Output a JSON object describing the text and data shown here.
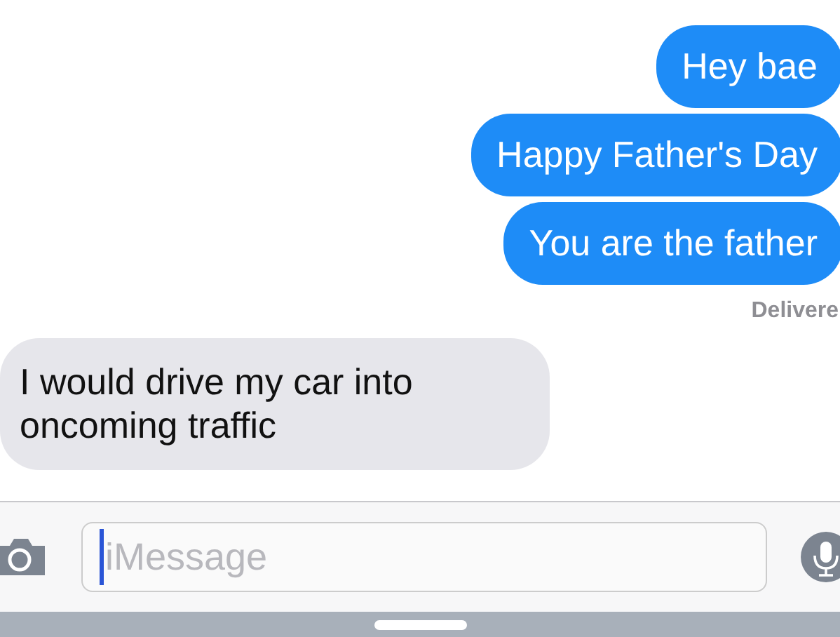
{
  "messages": [
    {
      "kind": "sent",
      "text": "Hey bae"
    },
    {
      "kind": "sent",
      "text": "Happy Father's Day"
    },
    {
      "kind": "sent",
      "text": "You are the father"
    },
    {
      "kind": "status",
      "text": "Delivere"
    },
    {
      "kind": "received",
      "text": "I would drive my car into oncoming traffic"
    }
  ],
  "composer": {
    "placeholder": "iMessage"
  }
}
